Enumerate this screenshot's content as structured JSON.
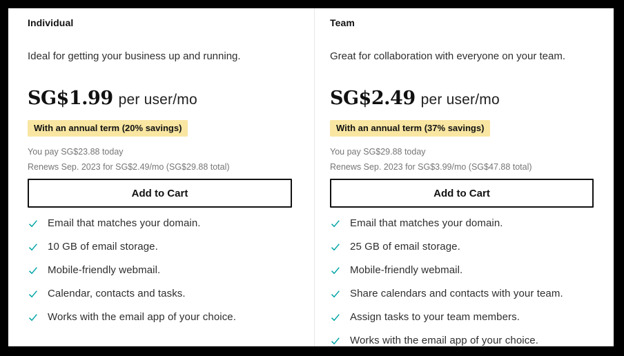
{
  "colors": {
    "frame": "#000000",
    "panel_bg": "#ffffff",
    "divider": "#e8e8e8",
    "heading_text": "#111111",
    "body_text": "#2e2e2e",
    "muted_text": "#767676",
    "accent_teal": "#00a4a6",
    "badge_bg": "#f8e6a2",
    "button_border": "#111111"
  },
  "plans": [
    {
      "name": "Individual",
      "description": "Ideal for getting your business up and running.",
      "price": "SG$1.99",
      "price_unit": "per user/mo",
      "term_badge": "With an annual term (20% savings)",
      "pay_today": "You pay SG$23.88 today",
      "renewal": "Renews Sep. 2023 for SG$2.49/mo (SG$29.88 total)",
      "cta_label": "Add to Cart",
      "features": [
        "Email that matches your domain.",
        "10 GB of email storage.",
        "Mobile-friendly webmail.",
        "Calendar, contacts and tasks.",
        "Works with the email app of your choice."
      ]
    },
    {
      "name": "Team",
      "description": "Great for collaboration with everyone on your team.",
      "price": "SG$2.49",
      "price_unit": "per user/mo",
      "term_badge": "With an annual term (37% savings)",
      "pay_today": "You pay SG$29.88 today",
      "renewal": "Renews Sep. 2023 for SG$3.99/mo (SG$47.88 total)",
      "cta_label": "Add to Cart",
      "features": [
        "Email that matches your domain.",
        "25 GB of email storage.",
        "Mobile-friendly webmail.",
        "Share calendars and contacts with your team.",
        "Assign tasks to your team members.",
        "Works with the email app of your choice."
      ]
    }
  ]
}
